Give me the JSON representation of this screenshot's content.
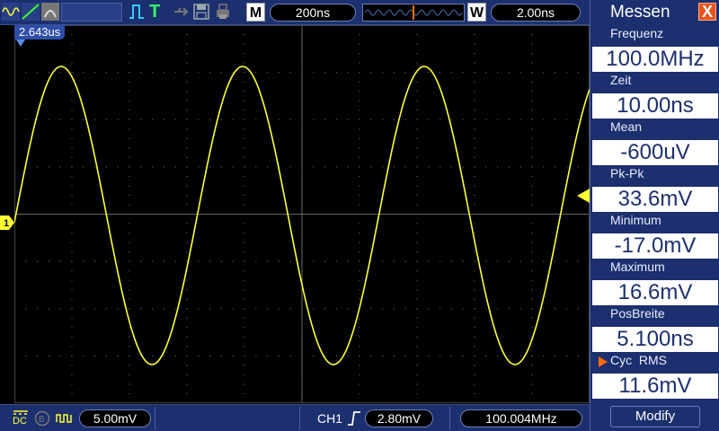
{
  "toolbar": {
    "timebase": "200ns",
    "mode_button": "M",
    "zoom_button": "W",
    "zoom_value": "2.00ns",
    "run_indicator": "T"
  },
  "screen": {
    "trigger_position": "2.643us",
    "channel_marker": "1"
  },
  "bottom": {
    "coupling": "DC",
    "ch1_scale": "5.00mV",
    "trigger_source": "CH1",
    "trigger_level": "2.80mV",
    "frequency_counter": "100.004MHz"
  },
  "measure": {
    "title": "Messen",
    "close": "X",
    "items": [
      {
        "label": "Frequenz",
        "value": "100.0MHz"
      },
      {
        "label": "Zeit",
        "value": "10.00ns"
      },
      {
        "label": "Mean",
        "value": "-600uV"
      },
      {
        "label": "Pk-Pk",
        "value": "33.6mV"
      },
      {
        "label": "Minimum",
        "value": "-17.0mV"
      },
      {
        "label": "Maximum",
        "value": "16.6mV"
      },
      {
        "label": "PosBreite",
        "value": "5.100ns"
      },
      {
        "label": "Cyc  RMS",
        "value": "11.6mV"
      }
    ],
    "modify": "Modify"
  },
  "colors": {
    "trace": "#ffff33",
    "accent": "#e8531e",
    "bar": "#1c2f6e"
  }
}
